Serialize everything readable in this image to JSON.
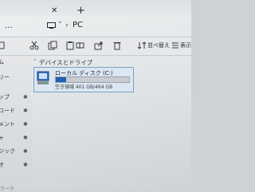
{
  "titlebar": {
    "tab_close": "✕",
    "tab_add": "+"
  },
  "address": {
    "more": "…",
    "chevron": "›",
    "location": "PC"
  },
  "toolbar": {
    "sort_label": "並べ替え",
    "view_label": "表示"
  },
  "sidebar": {
    "items": [
      {
        "label": "ム"
      },
      {
        "label": "リー"
      },
      {
        "label": "ップ",
        "pinned": true
      },
      {
        "label": "ロード",
        "pinned": true
      },
      {
        "label": "メント",
        "pinned": true
      },
      {
        "label": "ャ",
        "pinned": true
      },
      {
        "label": "ジック",
        "pinned": true
      },
      {
        "label": "オ",
        "pinned": true
      }
    ],
    "pin_glyph": "✱",
    "bottom_text": "ワーク"
  },
  "main": {
    "group_title": "デバイスとドライブ",
    "drive": {
      "name": "ローカル ディスク (C:)",
      "free_text": "空き領域 401 GB/464 GB",
      "used_fraction": 0.14
    }
  },
  "colors": {
    "accent": "#1f5fb6",
    "tile_bg": "#dbe6f2",
    "tile_border": "#7e9fc4"
  }
}
